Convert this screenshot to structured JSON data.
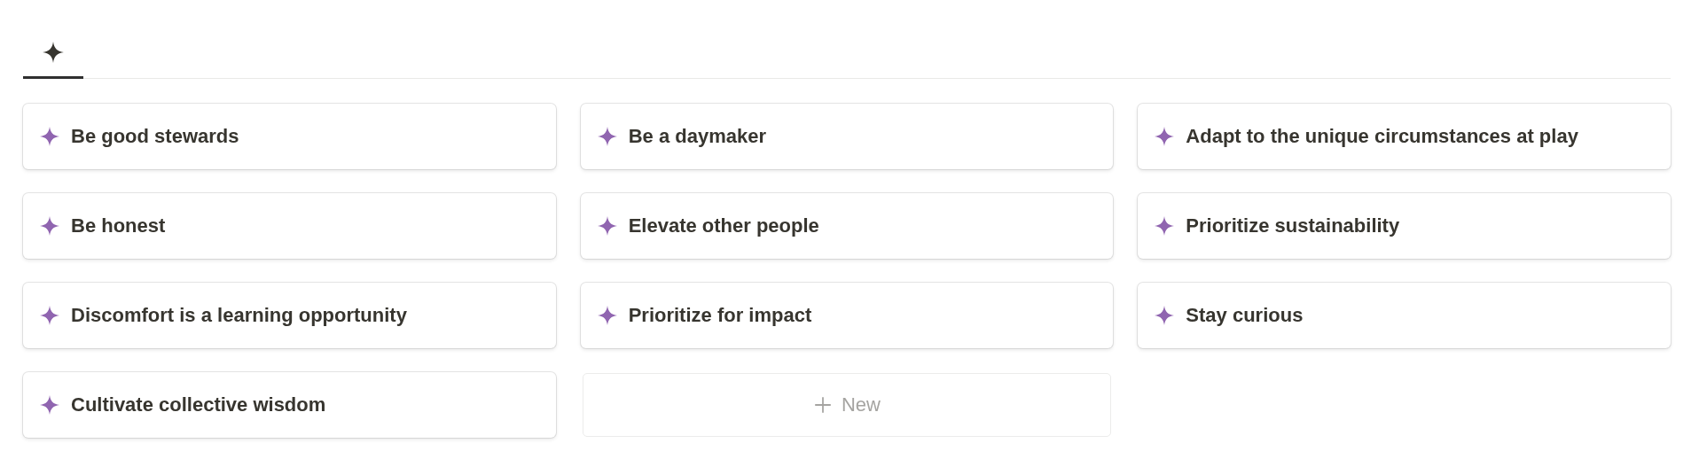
{
  "tabs": [
    {
      "selected": true
    }
  ],
  "cards": [
    {
      "title": "Be good stewards"
    },
    {
      "title": "Be a daymaker"
    },
    {
      "title": "Adapt to the unique circumstances at play"
    },
    {
      "title": "Be honest"
    },
    {
      "title": "Elevate other people"
    },
    {
      "title": "Prioritize sustainability"
    },
    {
      "title": "Discomfort is a learning opportunity"
    },
    {
      "title": "Prioritize for impact"
    },
    {
      "title": "Stay curious"
    },
    {
      "title": "Cultivate collective wisdom"
    }
  ],
  "new_button": {
    "label": "New"
  }
}
